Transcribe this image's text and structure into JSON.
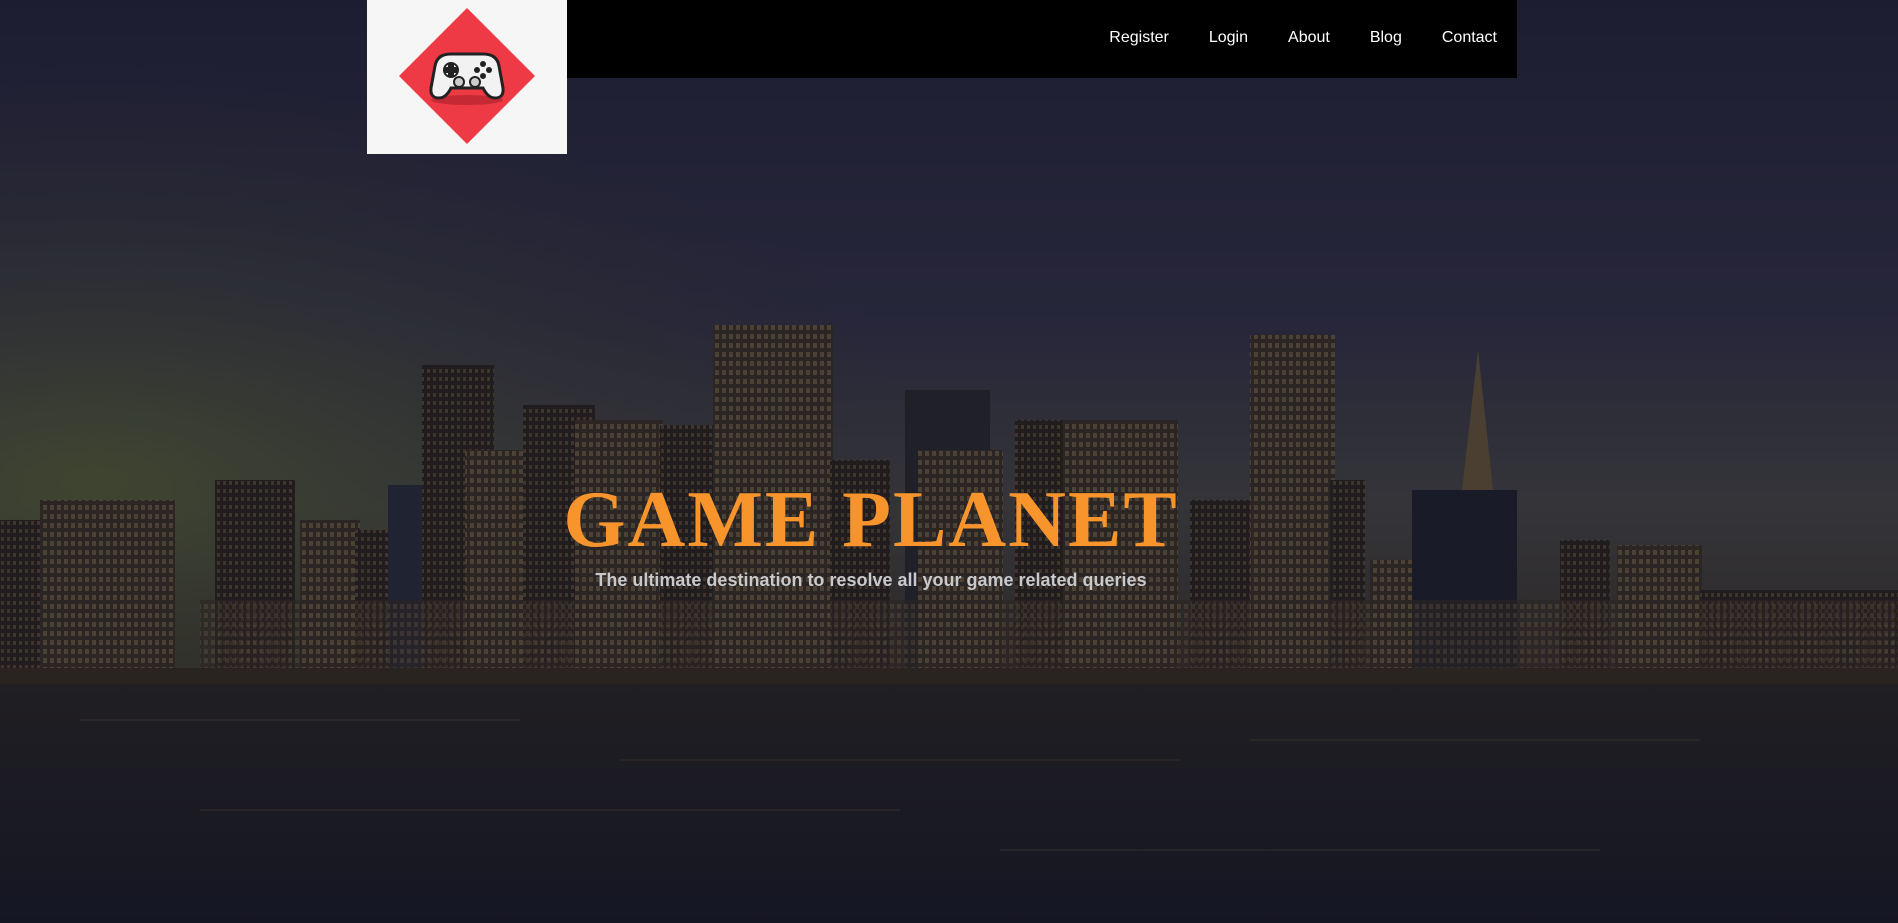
{
  "nav": {
    "items": [
      {
        "label": "Register"
      },
      {
        "label": "Login"
      },
      {
        "label": "About"
      },
      {
        "label": "Blog"
      },
      {
        "label": "Contact"
      }
    ]
  },
  "hero": {
    "title": "GAME PLANET",
    "subtitle": "The ultimate destination to resolve all your game related queries",
    "background": "city-skyline-waterfront-image"
  },
  "logo": {
    "icon": "gamepad-icon",
    "accent_color": "#ee3a45"
  },
  "colors": {
    "title": "#f7952c",
    "header": "#000000"
  }
}
